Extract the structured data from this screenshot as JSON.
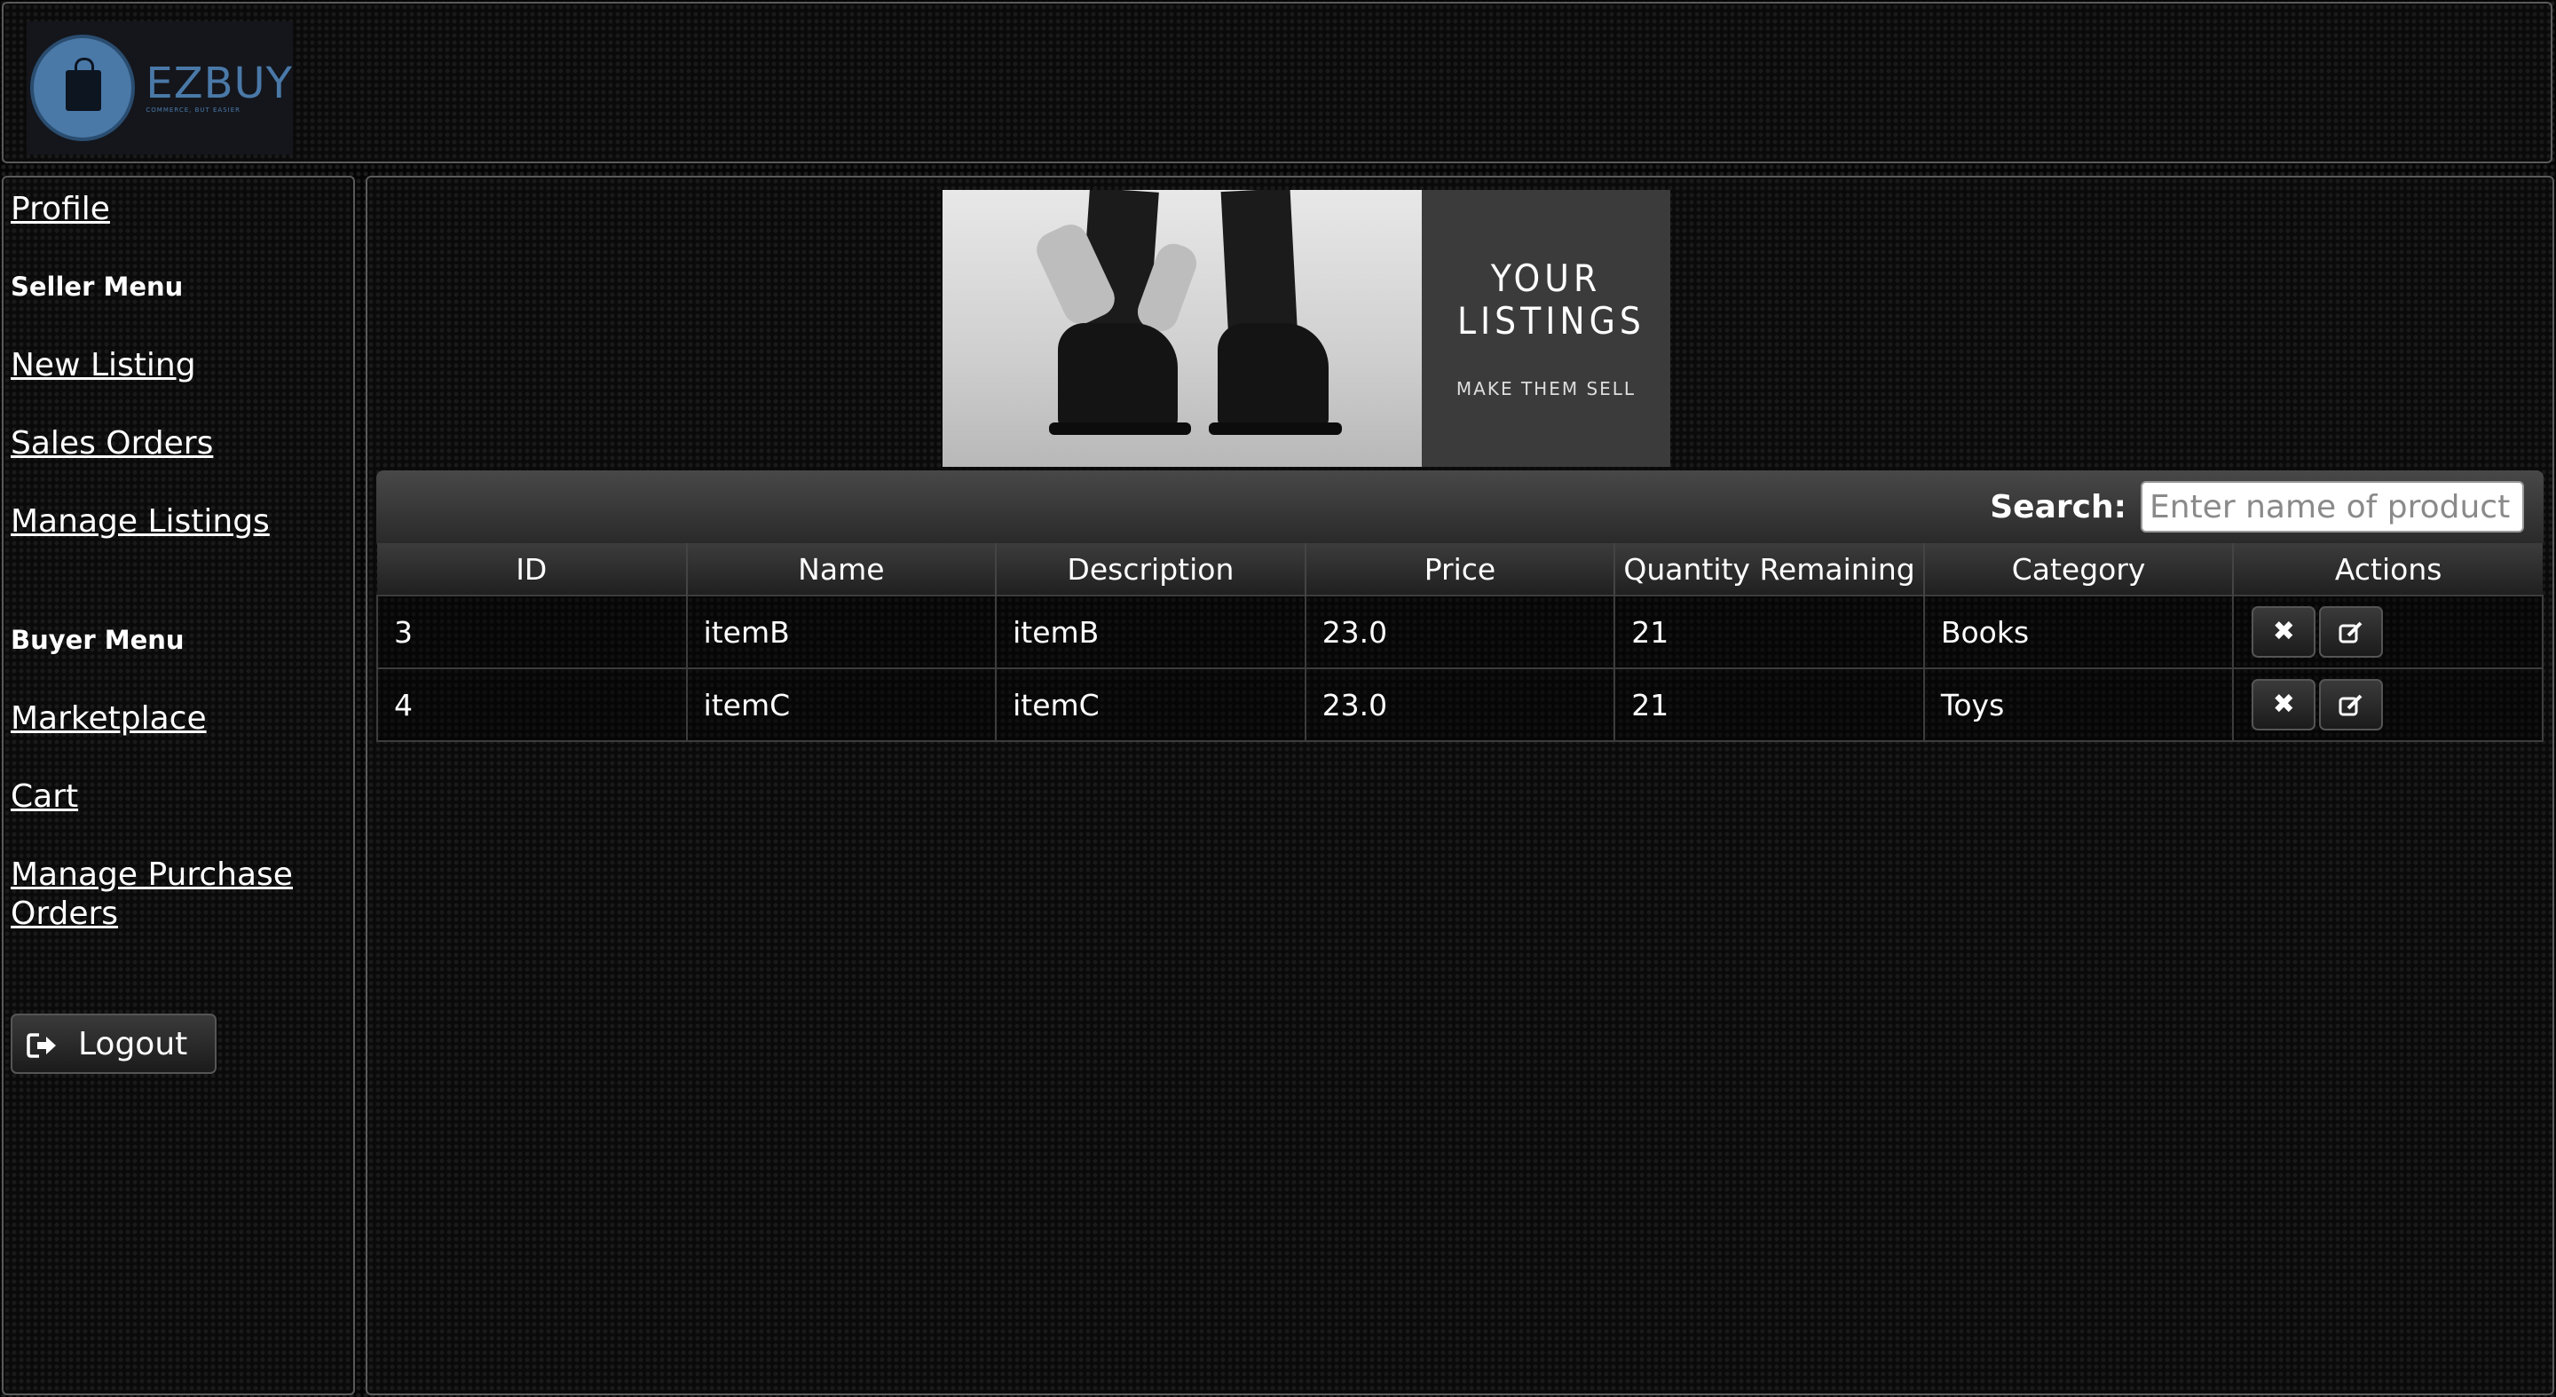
{
  "header": {
    "logo": {
      "name": "EZBUY",
      "tagline": "COMMERCE, BUT EASIER"
    }
  },
  "sidebar": {
    "profile_label": "Profile",
    "seller_heading": "Seller Menu",
    "seller_items": [
      "New Listing",
      "Sales Orders",
      "Manage Listings"
    ],
    "buyer_heading": "Buyer Menu",
    "buyer_items": [
      "Marketplace",
      "Cart",
      "Manage Purchase Orders"
    ],
    "logout_label": "Logout"
  },
  "banner": {
    "title": "YOUR LISTINGS",
    "subtitle": "MAKE THEM SELL"
  },
  "search": {
    "label": "Search:",
    "placeholder": "Enter name of product",
    "value": ""
  },
  "table": {
    "columns": [
      "ID",
      "Name",
      "Description",
      "Price",
      "Quantity Remaining",
      "Category",
      "Actions"
    ],
    "rows": [
      {
        "id": "3",
        "name": "itemB",
        "description": "itemB",
        "price": "23.0",
        "quantity": "21",
        "category": "Books"
      },
      {
        "id": "4",
        "name": "itemC",
        "description": "itemC",
        "price": "23.0",
        "quantity": "21",
        "category": "Toys"
      }
    ],
    "action_icons": [
      "delete-icon",
      "edit-icon"
    ]
  },
  "colors": {
    "logo_blue": "#4a79a8",
    "background": "#050505"
  }
}
